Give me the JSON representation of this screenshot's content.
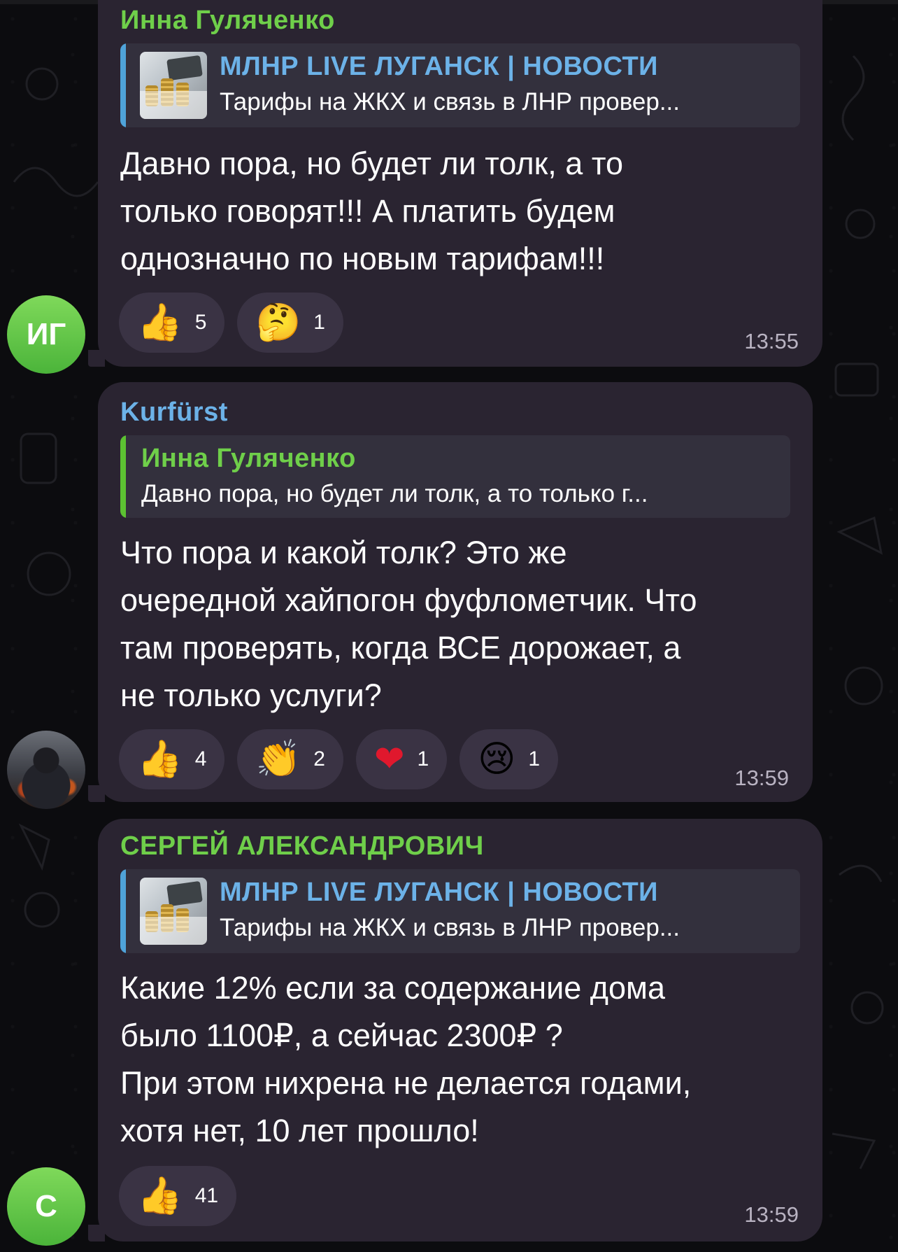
{
  "messages": [
    {
      "sender": "Инна Гуляченко",
      "avatar_initials": "ИГ",
      "reply": {
        "type": "channel",
        "title": "МЛНР LIVE ЛУГАНСК | НОВОСТИ",
        "text": "Тарифы на ЖКХ и связь в ЛНР провер..."
      },
      "text": "Давно пора, но будет ли толк, а то\nтолько говорят!!! А платить будем\nоднозначно по новым тарифам!!!",
      "reactions": [
        {
          "emoji": "👍",
          "count": "5"
        },
        {
          "emoji": "🤔",
          "count": "1"
        }
      ],
      "time": "13:55"
    },
    {
      "sender": "Kurfürst",
      "avatar_initials": "",
      "reply": {
        "type": "user",
        "title": "Инна Гуляченко",
        "text": "Давно пора, но будет ли толк, а то только г..."
      },
      "text": "Что пора и какой толк? Это же\nочередной хайпогон фуфлометчик. Что\nтам проверять, когда ВСЕ дорожает, а\nне только услуги?",
      "reactions": [
        {
          "emoji": "👍",
          "count": "4"
        },
        {
          "emoji": "👏",
          "count": "2"
        },
        {
          "emoji": "❤",
          "count": "1"
        },
        {
          "emoji": "😢",
          "count": "1"
        }
      ],
      "time": "13:59"
    },
    {
      "sender": "СЕРГЕЙ АЛЕКСАНДРОВИЧ",
      "avatar_initials": "С",
      "reply": {
        "type": "channel",
        "title": "МЛНР LIVE ЛУГАНСК | НОВОСТИ",
        "text": "Тарифы на ЖКХ и связь в ЛНР провер..."
      },
      "text": "Какие 12% если за содержание дома\nбыло 1100₽, а сейчас 2300₽ ?\nПри этом нихрена не делается годами,\nхотя нет, 10 лет прошло!",
      "reactions": [
        {
          "emoji": "👍",
          "count": "41"
        }
      ],
      "time": "13:59"
    }
  ],
  "colors": {
    "background": "#0c0c0f",
    "bubble": "#2a2431",
    "sender_green": "#6fcf4a",
    "sender_blue": "#6cb2e8",
    "reaction_bg": "#3a3344"
  }
}
